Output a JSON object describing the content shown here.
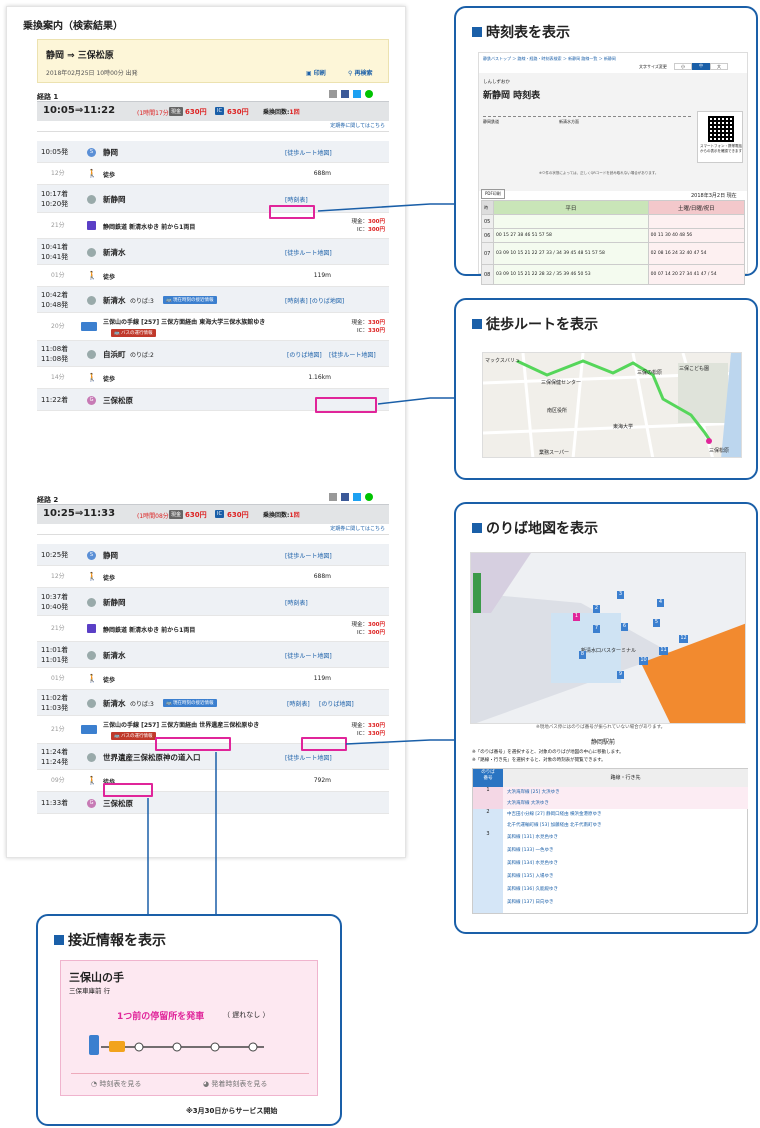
{
  "left_page": {
    "title": "乗換案内（検索結果）",
    "query_route": "静岡 ⇒ 三保松原",
    "query_date": "2018年02月25日 10時00分 出発",
    "print_label": "印刷",
    "research_label": "再検索",
    "route1": {
      "label": "経路 1",
      "time": "10:05⇒11:22",
      "duration": "(1時間17分)",
      "cash_badge": "現金",
      "cash_fare": "630円",
      "ic_badge": "IC",
      "ic_fare": "630円",
      "transfers_label": "乗換回数:",
      "transfers_value": "1回",
      "teiki_link": "定期券に関してはこちら",
      "rows": [
        {
          "time": "10:05発",
          "name": "静岡",
          "link": "[徒歩ルート地図]"
        },
        {
          "walk": "12分",
          "label": "徒歩",
          "dist": "688m"
        },
        {
          "time": "10:17着\n10:20発",
          "name": "新静岡",
          "link": "[時刻表]"
        },
        {
          "walk": "21分",
          "label": "静岡鉄道 新清水ゆき 前から1両目",
          "fare_cash": "現金：",
          "fare_cash_v": "300円",
          "fare_ic": "IC：",
          "fare_ic_v": "300円"
        },
        {
          "time": "10:41着\n10:41発",
          "name": "新清水",
          "link": "[徒歩ルート地図]"
        },
        {
          "walk": "01分",
          "label": "徒歩",
          "dist": "119m"
        },
        {
          "time": "10:42着\n10:48発",
          "name": "新清水",
          "sub": "のりば:3",
          "btn": "現在時刻の接近情報",
          "link": "[時刻表] [のりば地図]"
        },
        {
          "walk": "20分",
          "label": "三保山の手線 [257] 三保方面経由 東海大学三保水族館ゆき",
          "btn2": "バスの運行情報",
          "fare_cash": "現金：",
          "fare_cash_v": "330円",
          "fare_ic": "IC：",
          "fare_ic_v": "330円"
        },
        {
          "time": "11:08着\n11:08発",
          "name": "自浜町",
          "sub": "のりば:2",
          "link": "[のりば地図]",
          "link2": "[徒歩ルート地図]"
        },
        {
          "walk": "14分",
          "label": "徒歩",
          "dist": "1.16km"
        },
        {
          "time": "11:22着",
          "name": "三保松原"
        }
      ]
    },
    "route2": {
      "label": "経路 2",
      "time": "10:25⇒11:33",
      "duration": "(1時間08分)",
      "cash_badge": "現金",
      "cash_fare": "630円",
      "ic_badge": "IC",
      "ic_fare": "630円",
      "transfers_label": "乗換回数:",
      "transfers_value": "1回",
      "teiki_link": "定期券に関してはこちら",
      "rows": [
        {
          "time": "10:25発",
          "name": "静岡",
          "link": "[徒歩ルート地図]"
        },
        {
          "walk": "12分",
          "label": "徒歩",
          "dist": "688m"
        },
        {
          "time": "10:37着\n10:40発",
          "name": "新静岡",
          "link": "[時刻表]"
        },
        {
          "walk": "21分",
          "label": "静岡鉄道 新清水ゆき 前から1両目",
          "fare_cash": "現金：",
          "fare_cash_v": "300円",
          "fare_ic": "IC：",
          "fare_ic_v": "300円"
        },
        {
          "time": "11:01着\n11:01発",
          "name": "新清水",
          "link": "[徒歩ルート地図]"
        },
        {
          "walk": "01分",
          "label": "徒歩",
          "dist": "119m"
        },
        {
          "time": "11:02着\n11:03発",
          "name": "新清水",
          "sub": "のりば:3",
          "btn": "現在時刻の接近情報",
          "link": "[時刻表]",
          "link2": "[のりば地図]"
        },
        {
          "walk": "21分",
          "label": "三保山の手線 [257] 三保方面経由 世界遺産三保松原ゆき",
          "btn2": "バスの運行情報",
          "fare_cash": "現金：",
          "fare_cash_v": "330円",
          "fare_ic": "IC：",
          "fare_ic_v": "330円"
        },
        {
          "time": "11:24着\n11:24発",
          "name": "世界遺産三保松原神の道入口",
          "link": "[徒歩ルート地図]"
        },
        {
          "walk": "09分",
          "label": "徒歩",
          "dist": "792m"
        },
        {
          "time": "11:33着",
          "name": "三保松原"
        }
      ]
    }
  },
  "panel_timetable": {
    "title": "時刻表を表示",
    "breadcrumb": "静鉄バストップ ＞ 路線・経路・時刻表検索 ＞ 新静岡 路線一覧 ＞ 新静岡",
    "textsize": "文字サイズ変更",
    "ts": [
      "小",
      "中",
      "大"
    ],
    "kana": "しんしずおか",
    "station": "新静岡 時刻表",
    "c1": "静岡鉄道",
    "c2": "新清水方面",
    "qr_text": "スマートフォン・携帯電話からの表示を確認できます",
    "note": "※０件の状態によっては、正しくQRコードを読み取れない場合があります。",
    "pdf": "PDF印刷",
    "date": "2018年3月2日 現在",
    "h_weekday": "平日",
    "h_holiday": "土曜/日曜/祝日",
    "hours": [
      "05",
      "06",
      "07",
      "08"
    ],
    "weekday": [
      "",
      "00 15 27 38 46 51 57 58",
      "03 09 10 15 21 22 27 33 / 34 39 45 48 51 57 58",
      "03 09 10 15 21 22 28 32 / 35 39 46 50 53"
    ],
    "holiday": [
      "",
      "00 11 30 40 48 56",
      "02 08 16 24 32 40 47 54",
      "00 07 14 20 27 34 41 47 / 54"
    ]
  },
  "panel_walk": {
    "title": "徒歩ルートを表示",
    "labels": [
      "マックスバリュ",
      "三保保健センター",
      "南区役所",
      "三保こども園",
      "三保の松原",
      "業務スーパー",
      "東海大学",
      "三保松原"
    ]
  },
  "panel_noriba": {
    "title": "のりば地図を表示",
    "map_label": "新清水口バスターミナル",
    "map_note": "※現地バス停にはのりば番号が振られていない場合があります。",
    "station": "静岡駅前",
    "note1": "※「のりば番号」を選択すると、対象ののりばが地図の中心に移動します。",
    "note2": "※「路線・行き先」を選択すると、対象の時刻表が閲覧できます。",
    "h1": "のりば\n番号",
    "h2": "路線・行き先",
    "rows": [
      {
        "num": "1",
        "items": [
          "大浜海岸線 [25] 大浜ゆき",
          "大浜海岸線 大浜ゆき"
        ]
      },
      {
        "num": "2",
        "items": [
          "中吉田小分線 [27] 静岡口経由 横浜金港原ゆき",
          "北千代運輸町線 [53] 加藤経由 北千代南町ゆき"
        ]
      },
      {
        "num": "3",
        "items": [
          "美和線 [131] 水見色ゆき",
          "美和線 [133] 一色ゆき",
          "美和線 [134] 水見色ゆき",
          "美和線 [135] 入場ゆき",
          "美和線 [136] 久能殿ゆき",
          "美和線 [137] 日向ゆき"
        ]
      }
    ]
  },
  "panel_approach": {
    "title": "接近情報を表示",
    "line": "三保山の手",
    "dest": "三保車庫前 行",
    "status": "1つ前の停留所を発車",
    "delay": "（ 遅れなし ）",
    "btn1": "時刻表を見る",
    "btn2": "発着時刻表を見る",
    "footnote": "※3月30日からサービス開始"
  }
}
